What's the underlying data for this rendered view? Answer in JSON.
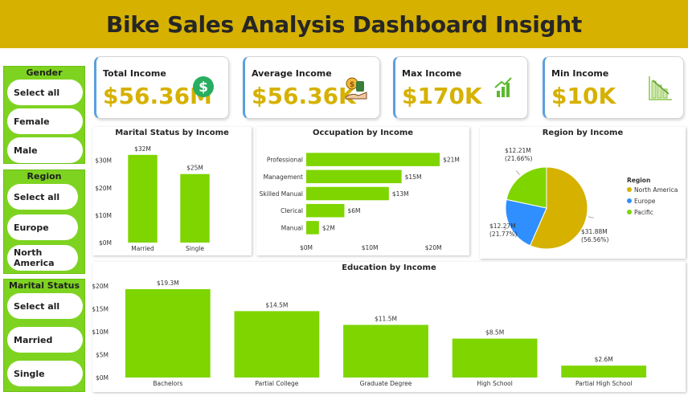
{
  "header": {
    "title": "Bike Sales Analysis Dashboard Insight"
  },
  "slicers": {
    "gender": {
      "title": "Gender",
      "options": [
        "Select all",
        "Female",
        "Male"
      ]
    },
    "region": {
      "title": "Region",
      "options": [
        "Select all",
        "Europe",
        "North America"
      ]
    },
    "marital": {
      "title": "Marital Status",
      "options": [
        "Select all",
        "Married",
        "Single"
      ]
    }
  },
  "kpis": [
    {
      "label": "Total Income",
      "value": "$56.36M",
      "icon": "dollar-circle-icon"
    },
    {
      "label": "Average Income",
      "value": "$56.36K",
      "icon": "money-hand-icon"
    },
    {
      "label": "Max Income",
      "value": "$170K",
      "icon": "bar-growth-icon"
    },
    {
      "label": "Min Income",
      "value": "$10K",
      "icon": "bar-decline-icon"
    }
  ],
  "colors": {
    "bar": "#7ed500",
    "gold": "#d6b100",
    "blue": "#2f8fff",
    "green": "#7ed500",
    "header": "#d6b100"
  },
  "chart_data": [
    {
      "id": "marital",
      "type": "bar",
      "title": "Marital Status by Income",
      "categories": [
        "Married",
        "Single"
      ],
      "values": [
        32,
        25
      ],
      "value_labels": [
        "$32M",
        "$25M"
      ],
      "yticks": [
        "$0M",
        "$10M",
        "$20M",
        "$30M"
      ],
      "ylim": [
        0,
        34
      ]
    },
    {
      "id": "occupation",
      "type": "bar",
      "orientation": "horizontal",
      "title": "Occupation by Income",
      "categories": [
        "Professional",
        "Management",
        "Skilled Manual",
        "Clerical",
        "Manual"
      ],
      "values": [
        21,
        15,
        13,
        6,
        2
      ],
      "value_labels": [
        "$21M",
        "$15M",
        "$13M",
        "$6M",
        "$2M"
      ],
      "xticks": [
        "$0M",
        "$10M",
        "$20M"
      ],
      "xlim": [
        0,
        22
      ]
    },
    {
      "id": "region",
      "type": "pie",
      "title": "Region by Income",
      "legend_title": "Region",
      "labels": [
        "North America",
        "Europe",
        "Pacific"
      ],
      "values": [
        31.88,
        12.27,
        12.21
      ],
      "value_labels": [
        "$31.88M",
        "$12.27M",
        "$12.21M"
      ],
      "percent_labels": [
        "(56.56%)",
        "(21.77%)",
        "(21.66%)"
      ],
      "colors": [
        "#d6b100",
        "#2f8fff",
        "#7ed500"
      ],
      "legend_position": "right"
    },
    {
      "id": "education",
      "type": "bar",
      "title": "Education by Income",
      "categories": [
        "Bachelors",
        "Partial College",
        "Graduate Degree",
        "High School",
        "Partial High School"
      ],
      "values": [
        19.3,
        14.5,
        11.5,
        8.5,
        2.6
      ],
      "value_labels": [
        "$19.3M",
        "$14.5M",
        "$11.5M",
        "$8.5M",
        "$2.6M"
      ],
      "yticks": [
        "$0M",
        "$5M",
        "$10M",
        "$15M",
        "$20M"
      ],
      "ylim": [
        0,
        20
      ]
    }
  ]
}
